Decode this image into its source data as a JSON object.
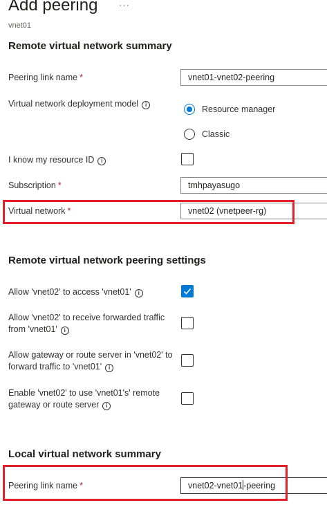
{
  "header": {
    "title": "Add peering",
    "more_label": "···",
    "subtitle": "vnet01"
  },
  "remote_summary": {
    "heading": "Remote virtual network summary",
    "peering_link_name": {
      "label": "Peering link name",
      "required": "*",
      "value": "vnet01-vnet02-peering"
    },
    "deployment_model": {
      "label": "Virtual network deployment model",
      "options": [
        {
          "label": "Resource manager",
          "selected": true
        },
        {
          "label": "Classic",
          "selected": false
        }
      ]
    },
    "know_resource_id": {
      "label": "I know my resource ID",
      "checked": false
    },
    "subscription": {
      "label": "Subscription",
      "required": "*",
      "value": "tmhpayasugo"
    },
    "virtual_network": {
      "label": "Virtual network",
      "required": "*",
      "value": "vnet02 (vnetpeer-rg)"
    }
  },
  "remote_settings": {
    "heading": "Remote virtual network peering settings",
    "options": [
      {
        "line1": "Allow 'vnet02' to access 'vnet01'",
        "line2": "",
        "checked": true
      },
      {
        "line1": "Allow 'vnet02' to receive forwarded traffic",
        "line2": "from 'vnet01'",
        "checked": false
      },
      {
        "line1": "Allow gateway or route server in 'vnet02' to",
        "line2": "forward traffic to 'vnet01'",
        "checked": false
      },
      {
        "line1": "Enable 'vnet02' to use 'vnet01's' remote",
        "line2": "gateway or route server",
        "checked": false
      }
    ]
  },
  "local_summary": {
    "heading": "Local virtual network summary",
    "peering_link_name": {
      "label": "Peering link name",
      "required": "*",
      "value_before_caret": "vnet02-vnet01",
      "value_after_caret": "-peering"
    }
  },
  "icons": {
    "info": "info-icon",
    "check": "checkmark-icon",
    "more": "more-icon"
  },
  "colors": {
    "accent": "#0078d4",
    "highlight": "#e3202a",
    "required": "#a4262c"
  }
}
